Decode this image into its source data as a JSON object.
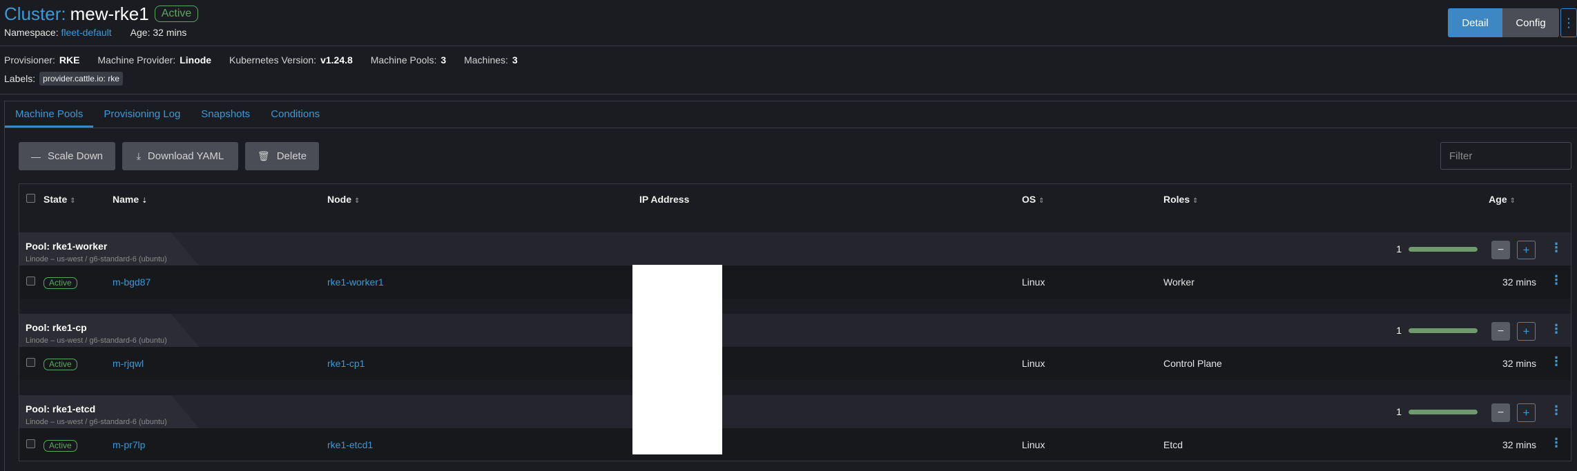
{
  "header": {
    "title_label": "Cluster:",
    "cluster_name": "mew-rke1",
    "status": "Active",
    "namespace_label": "Namespace:",
    "namespace": "fleet-default",
    "age_label": "Age:",
    "age": "32 mins"
  },
  "top_buttons": {
    "detail": "Detail",
    "config": "Config",
    "more": "⋮"
  },
  "meta": [
    {
      "key": "Provisioner:",
      "value": "RKE"
    },
    {
      "key": "Machine Provider:",
      "value": "Linode"
    },
    {
      "key": "Kubernetes Version:",
      "value": "v1.24.8"
    },
    {
      "key": "Machine Pools:",
      "value": "3"
    },
    {
      "key": "Machines:",
      "value": "3"
    }
  ],
  "labels": {
    "label": "Labels:",
    "chip": "provider.cattle.io: rke"
  },
  "tabs": [
    {
      "label": "Machine Pools",
      "active": true
    },
    {
      "label": "Provisioning Log",
      "active": false
    },
    {
      "label": "Snapshots",
      "active": false
    },
    {
      "label": "Conditions",
      "active": false
    }
  ],
  "toolbar": {
    "scale_down": "Scale Down",
    "download_yaml": "Download YAML",
    "delete": "Delete",
    "filter_placeholder": "Filter"
  },
  "columns": {
    "state": "State",
    "name": "Name",
    "node": "Node",
    "ip": "IP Address",
    "os": "OS",
    "roles": "Roles",
    "age": "Age"
  },
  "pools": [
    {
      "title": "Pool: rke1-worker",
      "subtitle": "Linode – us-west / g6-standard-6 (ubuntu)",
      "count": "1",
      "ready_fraction": 1.0,
      "machine": {
        "state": "Active",
        "name": "m-bgd87",
        "node": "rke1-worker1",
        "os": "Linux",
        "roles": "Worker",
        "age": "32 mins"
      }
    },
    {
      "title": "Pool: rke1-cp",
      "subtitle": "Linode – us-west / g6-standard-6 (ubuntu)",
      "count": "1",
      "ready_fraction": 1.0,
      "machine": {
        "state": "Active",
        "name": "m-rjqwl",
        "node": "rke1-cp1",
        "os": "Linux",
        "roles": "Control Plane",
        "age": "32 mins"
      }
    },
    {
      "title": "Pool: rke1-etcd",
      "subtitle": "Linode – us-west / g6-standard-6 (ubuntu)",
      "count": "1",
      "ready_fraction": 1.0,
      "machine": {
        "state": "Active",
        "name": "m-pr7lp",
        "node": "rke1-etcd1",
        "os": "Linux",
        "roles": "Etcd",
        "age": "32 mins"
      }
    }
  ],
  "colors": {
    "accent": "#3d87c5",
    "link": "#3d98d3",
    "success": "#5ba660",
    "bar": "#6e9a6d"
  }
}
